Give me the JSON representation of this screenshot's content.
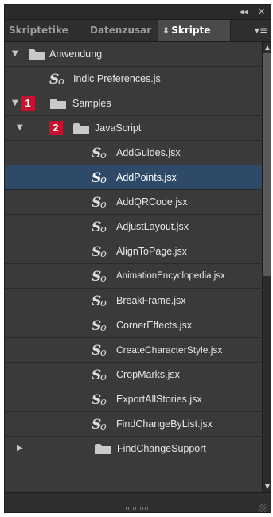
{
  "topbar": {
    "collapse_label": "◂◂",
    "close_label": "✕"
  },
  "tabs": [
    {
      "label": "Skriptetike"
    },
    {
      "label": "Datenzusar"
    },
    {
      "label": "Skripte",
      "sort_glyph": "⇳"
    }
  ],
  "menu_glyph": "▾≡",
  "rows": [
    {
      "label": "Anwendung",
      "icon": "folder-icon",
      "disclosure": "▼"
    },
    {
      "label": "Indic Preferences.js",
      "icon": "script-icon"
    },
    {
      "label": "Samples",
      "icon": "folder-icon",
      "disclosure": "▼",
      "badge": "1"
    },
    {
      "label": "JavaScript",
      "icon": "folder-icon",
      "disclosure": "▼",
      "badge": "2"
    },
    {
      "label": "AddGuides.jsx",
      "icon": "script-icon"
    },
    {
      "label": "AddPoints.jsx",
      "icon": "script-icon",
      "selected": true
    },
    {
      "label": "AddQRCode.jsx",
      "icon": "script-icon"
    },
    {
      "label": "AdjustLayout.jsx",
      "icon": "script-icon"
    },
    {
      "label": "AlignToPage.jsx",
      "icon": "script-icon"
    },
    {
      "label": "AnimationEncyclopedia.jsx",
      "icon": "script-icon"
    },
    {
      "label": "BreakFrame.jsx",
      "icon": "script-icon"
    },
    {
      "label": "CornerEffects.jsx",
      "icon": "script-icon"
    },
    {
      "label": "CreateCharacterStyle.jsx",
      "icon": "script-icon"
    },
    {
      "label": "CropMarks.jsx",
      "icon": "script-icon"
    },
    {
      "label": "ExportAllStories.jsx",
      "icon": "script-icon"
    },
    {
      "label": "FindChangeByList.jsx",
      "icon": "script-icon"
    },
    {
      "label": "FindChangeSupport",
      "icon": "folder-icon",
      "disclosure": "▶"
    }
  ],
  "scrollbar": {
    "up": "▲",
    "down": "▼"
  },
  "colors": {
    "panel_bg": "#3a3a3a",
    "selection": "#2e4a68",
    "badge": "#c8102e"
  }
}
